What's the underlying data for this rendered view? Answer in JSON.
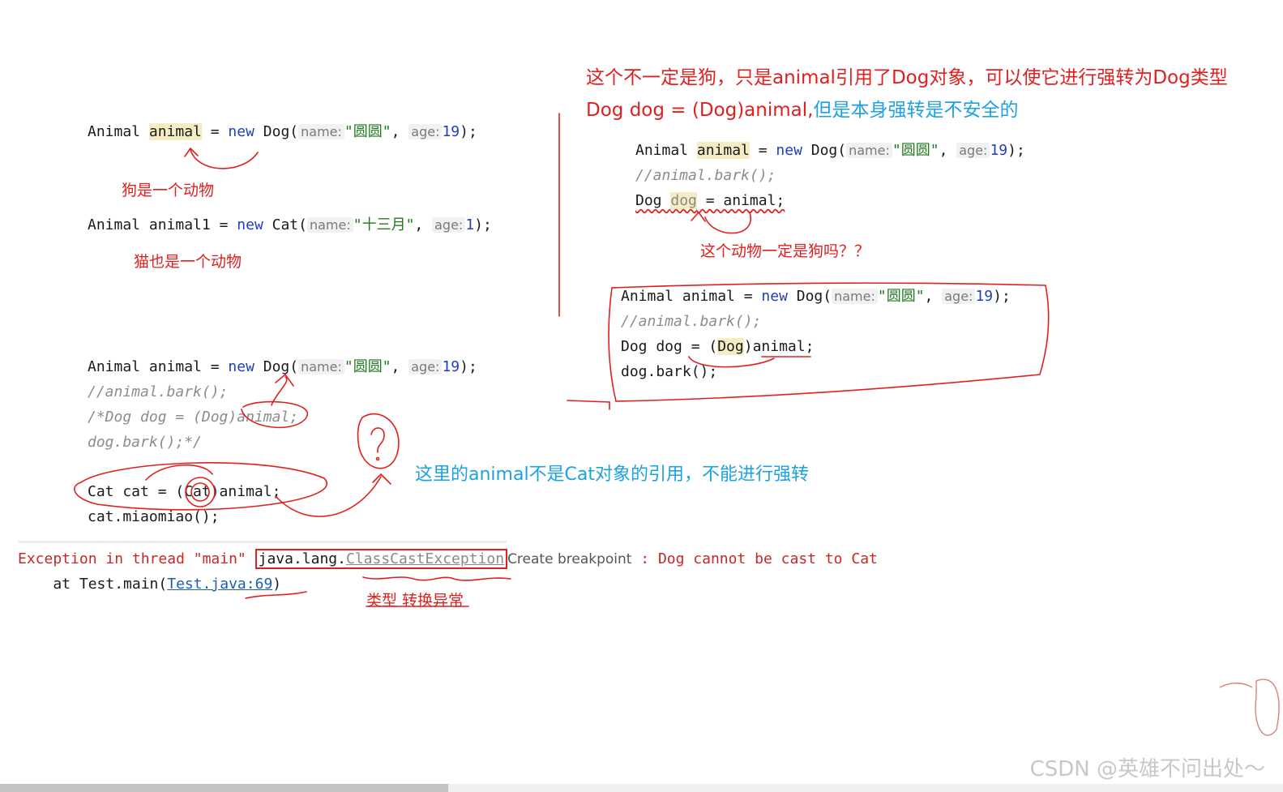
{
  "snippet_a": {
    "t_animal": "Animal",
    "v_animal": "animal",
    "op_eq": " = ",
    "kw_new": "new",
    "t_dog": " Dog(",
    "p_name": "name:",
    "s_name": "\"圆圆\"",
    "comma": ", ",
    "p_age": "age:",
    "n_age": "19",
    "end": ");",
    "note": "狗是一个动物"
  },
  "snippet_b": {
    "t_animal": "Animal",
    "v_animal1": " animal1 ",
    "op_eq": "= ",
    "kw_new": "new",
    "t_cat": " Cat(",
    "p_name": "name:",
    "s_name": "\"十三月\"",
    "comma": ", ",
    "p_age": "age:",
    "n_age": "1",
    "end": ");",
    "note": "猫也是一个动物"
  },
  "snippet_c": {
    "l1_t": "Animal animal = ",
    "l1_kw": "new",
    "l1_dog": " Dog(",
    "p_name": "name:",
    "s_name": "\"圆圆\"",
    "comma": ", ",
    "p_age": "age:",
    "n_age": "19",
    "end": ");",
    "l2": "//animal.bark();",
    "l3": "/*Dog dog = (Dog)animal;",
    "l4": "dog.bark();*/",
    "l5": "Cat cat = (Cat)animal;",
    "l6": "cat.miaomiao();"
  },
  "snippet_d": {
    "l1_t": "Animal ",
    "l1_v": "animal",
    "l1_eq": " = ",
    "l1_kw": "new",
    "l1_dog": " Dog(",
    "p_name": "name:",
    "s_name": "\"圆圆\"",
    "comma": ", ",
    "p_age": "age:",
    "n_age": "19",
    "end": ");",
    "l2": "//animal.bark();",
    "l3_a": "Dog ",
    "l3_v": "dog",
    "l3_b": " = animal;",
    "note": "这个动物一定是狗吗？？"
  },
  "snippet_e": {
    "l1_t": "Animal animal = ",
    "l1_kw": "new",
    "l1_dog": " Dog(",
    "p_name": "name:",
    "s_name": "\"圆圆\"",
    "comma": ", ",
    "p_age": "age:",
    "n_age": "19",
    "end": ");",
    "l2": "//animal.bark();",
    "l3_a": "Dog dog = (",
    "l3_v": "Dog",
    "l3_b": ")animal;",
    "l4": "dog.bark();"
  },
  "notes": {
    "top_red": "这个不一定是狗，只是animal引用了Dog对象，可以使它进行强转为Dog类型",
    "second_red": "Dog dog = (Dog)animal,",
    "second_blue": "但是本身强转是不安全的",
    "cat_blue": "这里的animal不是Cat对象的引用，不能进行强转",
    "type_exc": "类型 转换异常"
  },
  "console": {
    "line1_pre": "Exception in thread \"main\" ",
    "line1_pkg": "java.lang.",
    "line1_cls": "ClassCastException",
    "popup": "Create breakpoint",
    "line1_post": " : Dog cannot be cast to Cat",
    "line2_pre": "    at Test.main(",
    "line2_link": "Test.java:69",
    "line2_post": ")"
  },
  "watermark": "CSDN @英雄不问出处～",
  "colors": {
    "red": "#e0201f",
    "blue": "#1ea1e0",
    "keyword": "#1f3ec2",
    "string": "#1f7a1f"
  }
}
